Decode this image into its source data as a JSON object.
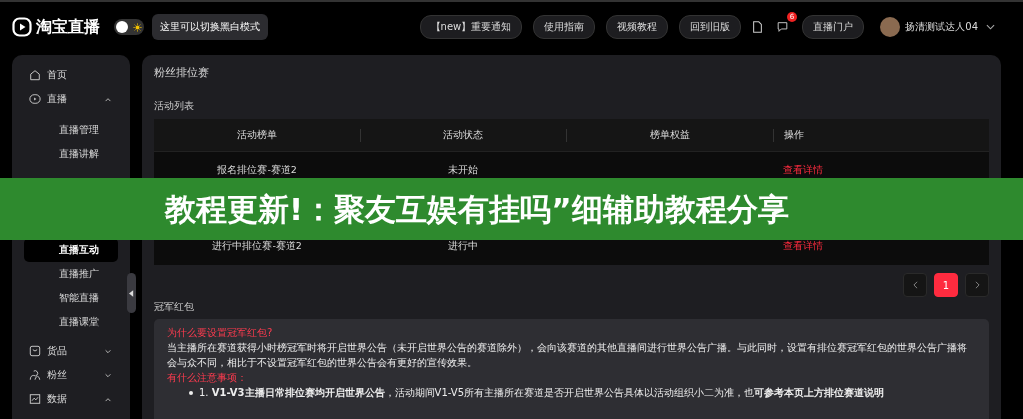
{
  "header": {
    "logo": "淘宝直播",
    "theme_toggle_on": false,
    "theme_tooltip": "这里可以切换黑白模式",
    "links": [
      "【new】重要通知",
      "使用指南",
      "视频教程",
      "回到旧版"
    ],
    "message_badge": "6",
    "portal": "直播门户",
    "user": "扬清测试达人04"
  },
  "sidebar": {
    "items": [
      {
        "label": "首页"
      },
      {
        "label": "直播",
        "expanded": true,
        "children": [
          {
            "label": "直播管理",
            "selected": false
          },
          {
            "label": "直播讲解",
            "selected": false
          },
          {
            "label": "直播互动",
            "selected": true
          },
          {
            "label": "直播推广",
            "selected": false
          },
          {
            "label": "智能直播",
            "selected": false
          },
          {
            "label": "直播课堂",
            "selected": false
          }
        ]
      },
      {
        "label": "货品",
        "expanded": false
      },
      {
        "label": "粉丝",
        "expanded": false
      },
      {
        "label": "数据",
        "expanded": true
      }
    ]
  },
  "page": {
    "title": "粉丝排位赛",
    "list_title": "活动列表",
    "table": {
      "columns": [
        "活动榜单",
        "活动状态",
        "榜单权益",
        "操作"
      ],
      "rows": [
        {
          "name": "报名排位赛-赛道2",
          "status": "未开始",
          "action": "查看详情"
        },
        {
          "name": "进行中排位赛-赛道2",
          "status": "进行中",
          "action": "查看详情"
        }
      ]
    },
    "pagination": [
      {
        "label": "1",
        "selected": true
      }
    ],
    "section_title": "冠军红包",
    "notice": [
      {
        "kind": "heading",
        "text": "为什么要设置冠军红包?"
      },
      {
        "kind": "para",
        "text": "当主播所在赛道获得小时榜冠军时将开启世界公告（未开启世界公告的赛道除外），会向该赛道的其他直播间进行世界公告广播。与此同时，设置有排位赛冠军红包的世界公告广播将会与众不同，相比于不设置冠军红包的世界公告会有更好的宣传效果。"
      },
      {
        "kind": "heading",
        "text": "有什么注意事项："
      },
      {
        "kind": "bullet",
        "text": "1. **V1-V3主播日常排位赛均开启世界公告**，活动期间V1-V5所有主播所在赛道是否开启世界公告具体以活动组织小二为准，也**可参考本页上方排位赛道说明**"
      }
    ]
  },
  "banner": "教程更新!：聚友互娱有挂吗”细辅助教程分享"
}
